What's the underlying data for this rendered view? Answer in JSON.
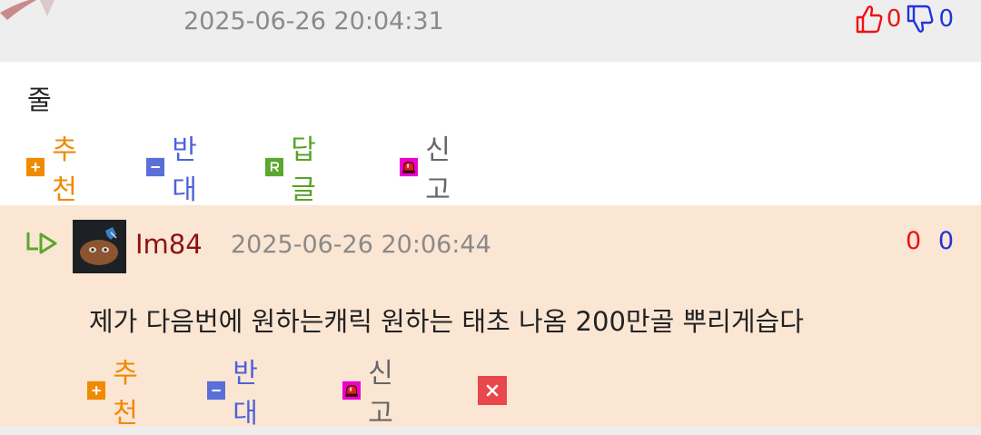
{
  "top_comment": {
    "date": "2025-06-26 20:04:31",
    "upvotes": "0",
    "downvotes": "0",
    "text": "줄",
    "actions": {
      "recommend": "추천",
      "oppose": "반대",
      "reply": "답글",
      "report": "신고"
    }
  },
  "reply": {
    "author": "Im84",
    "date": "2025-06-26 20:06:44",
    "upvotes": "0",
    "downvotes": "0",
    "text": "제가 다음번에 원하는캐릭 원하는 태초 나옴 200만골 뿌리게습다",
    "actions": {
      "recommend": "추천",
      "oppose": "반대",
      "report": "신고"
    }
  },
  "icons": {
    "thumbs_up": "thumbs-up-icon",
    "thumbs_down": "thumbs-down-icon",
    "plus": "plus-icon",
    "minus": "minus-icon",
    "reply": "reply-r-icon",
    "siren": "siren-icon",
    "delete": "delete-x-icon",
    "reply_arrow": "reply-arrow-icon"
  },
  "colors": {
    "upvote": "#ee1111",
    "downvote": "#2233dd",
    "recommend": "#f08a00",
    "oppose": "#4e62d6",
    "reply": "#58a32a",
    "report_icon": "#ee00cc",
    "delete": "#e8474b",
    "author": "#8e1111",
    "reply_background": "#fbe6d4"
  }
}
